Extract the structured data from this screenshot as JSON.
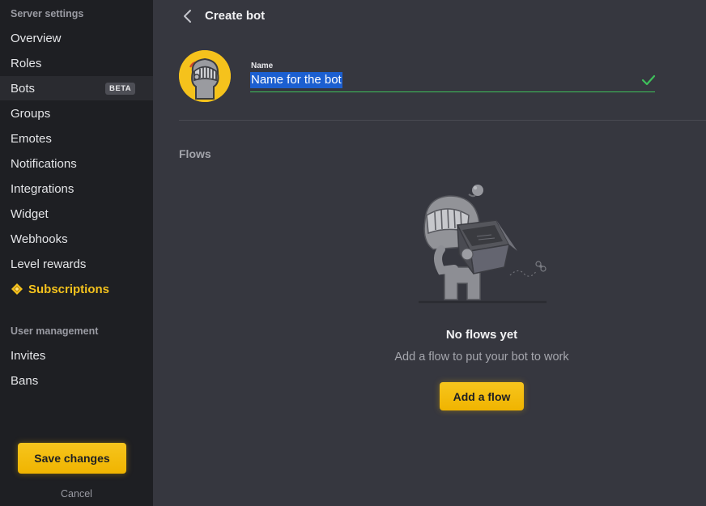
{
  "sidebar": {
    "server_settings_title": "Server settings",
    "items": [
      {
        "label": "Overview"
      },
      {
        "label": "Roles"
      },
      {
        "label": "Bots",
        "badge": "BETA"
      },
      {
        "label": "Groups"
      },
      {
        "label": "Emotes"
      },
      {
        "label": "Notifications"
      },
      {
        "label": "Integrations"
      },
      {
        "label": "Widget"
      },
      {
        "label": "Webhooks"
      },
      {
        "label": "Level rewards"
      },
      {
        "label": "Subscriptions",
        "icon": "diamond-icon"
      }
    ],
    "user_management_title": "User management",
    "user_items": [
      {
        "label": "Invites"
      },
      {
        "label": "Bans"
      }
    ],
    "save_label": "Save changes",
    "cancel_label": "Cancel"
  },
  "header": {
    "title": "Create bot"
  },
  "bot": {
    "name_label": "Name",
    "name_value": "Name for the bot"
  },
  "flows": {
    "title": "Flows",
    "empty_title": "No flows yet",
    "empty_subtitle": "Add a flow to put your bot to work",
    "add_label": "Add a flow"
  },
  "colors": {
    "accent": "#f5c21c",
    "sidebar_bg": "#1e1f23",
    "main_bg": "#36373f",
    "valid": "#3ec15b",
    "selection": "#1c5fd0"
  }
}
